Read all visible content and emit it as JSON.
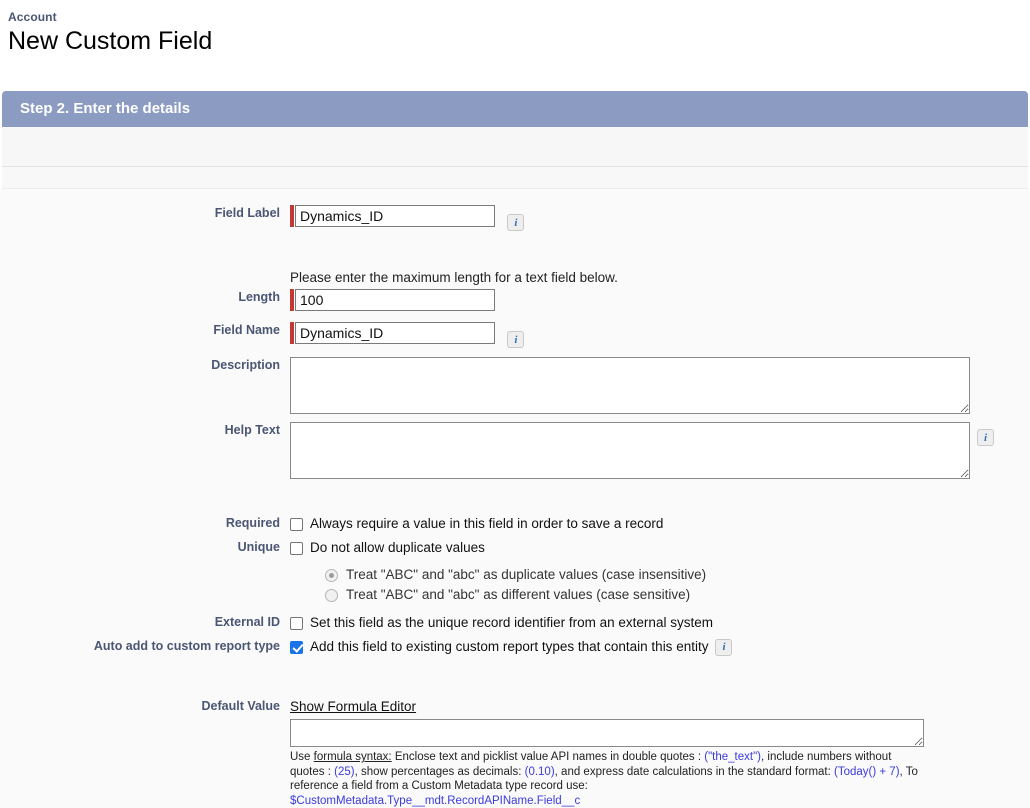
{
  "header": {
    "object_name": "Account",
    "page_title": "New Custom Field"
  },
  "step": {
    "banner_label": "Step 2. Enter the details"
  },
  "form": {
    "field_label": {
      "label": "Field Label",
      "value": "Dynamics_ID",
      "info_icon": "i",
      "required": true
    },
    "length_helper": "Please enter the maximum length for a text field below.",
    "length": {
      "label": "Length",
      "value": "100",
      "required": true
    },
    "field_name": {
      "label": "Field Name",
      "value": "Dynamics_ID",
      "info_icon": "i",
      "required": true
    },
    "description": {
      "label": "Description",
      "value": ""
    },
    "help_text": {
      "label": "Help Text",
      "value": "",
      "info_icon": "i"
    },
    "required": {
      "label": "Required",
      "checkbox_label": "Always require a value in this field in order to save a record",
      "checked": false
    },
    "unique": {
      "label": "Unique",
      "checkbox_label": "Do not allow duplicate values",
      "checked": false,
      "options": [
        {
          "label": "Treat \"ABC\" and \"abc\" as duplicate values (case insensitive)",
          "selected": true
        },
        {
          "label": "Treat \"ABC\" and \"abc\" as different values (case sensitive)",
          "selected": false
        }
      ]
    },
    "external_id": {
      "label": "External ID",
      "checkbox_label": "Set this field as the unique record identifier from an external system",
      "checked": false
    },
    "auto_add_report": {
      "label": "Auto add to custom report type",
      "checkbox_label": "Add this field to existing custom report types that contain this entity",
      "checked": true,
      "info_icon": "i"
    },
    "default_value": {
      "label": "Default Value",
      "formula_editor_link": "Show Formula Editor",
      "value": "",
      "note": {
        "t1": "Use ",
        "u1": "formula syntax:",
        "t2": " Enclose text and picklist value API names in double quotes : ",
        "b1": "(\"the_text\")",
        "t3": ", include numbers without quotes : ",
        "b2": "(25)",
        "t4": ", show percentages as decimals: ",
        "b3": "(0.10)",
        "t5": ", and express date calculations in the standard format: ",
        "b4": "(Today() + 7)",
        "t6": ", To reference a field from a Custom Metadata type record use:",
        "b5": "$CustomMetadata.Type__mdt.RecordAPIName.Field__c"
      }
    }
  },
  "colors": {
    "banner": "#8b9bc1",
    "required_marker": "#c23934",
    "label_text": "#4a5673",
    "checkbox_checked": "#1a73e8",
    "formula_blue": "#3b3bdd"
  }
}
